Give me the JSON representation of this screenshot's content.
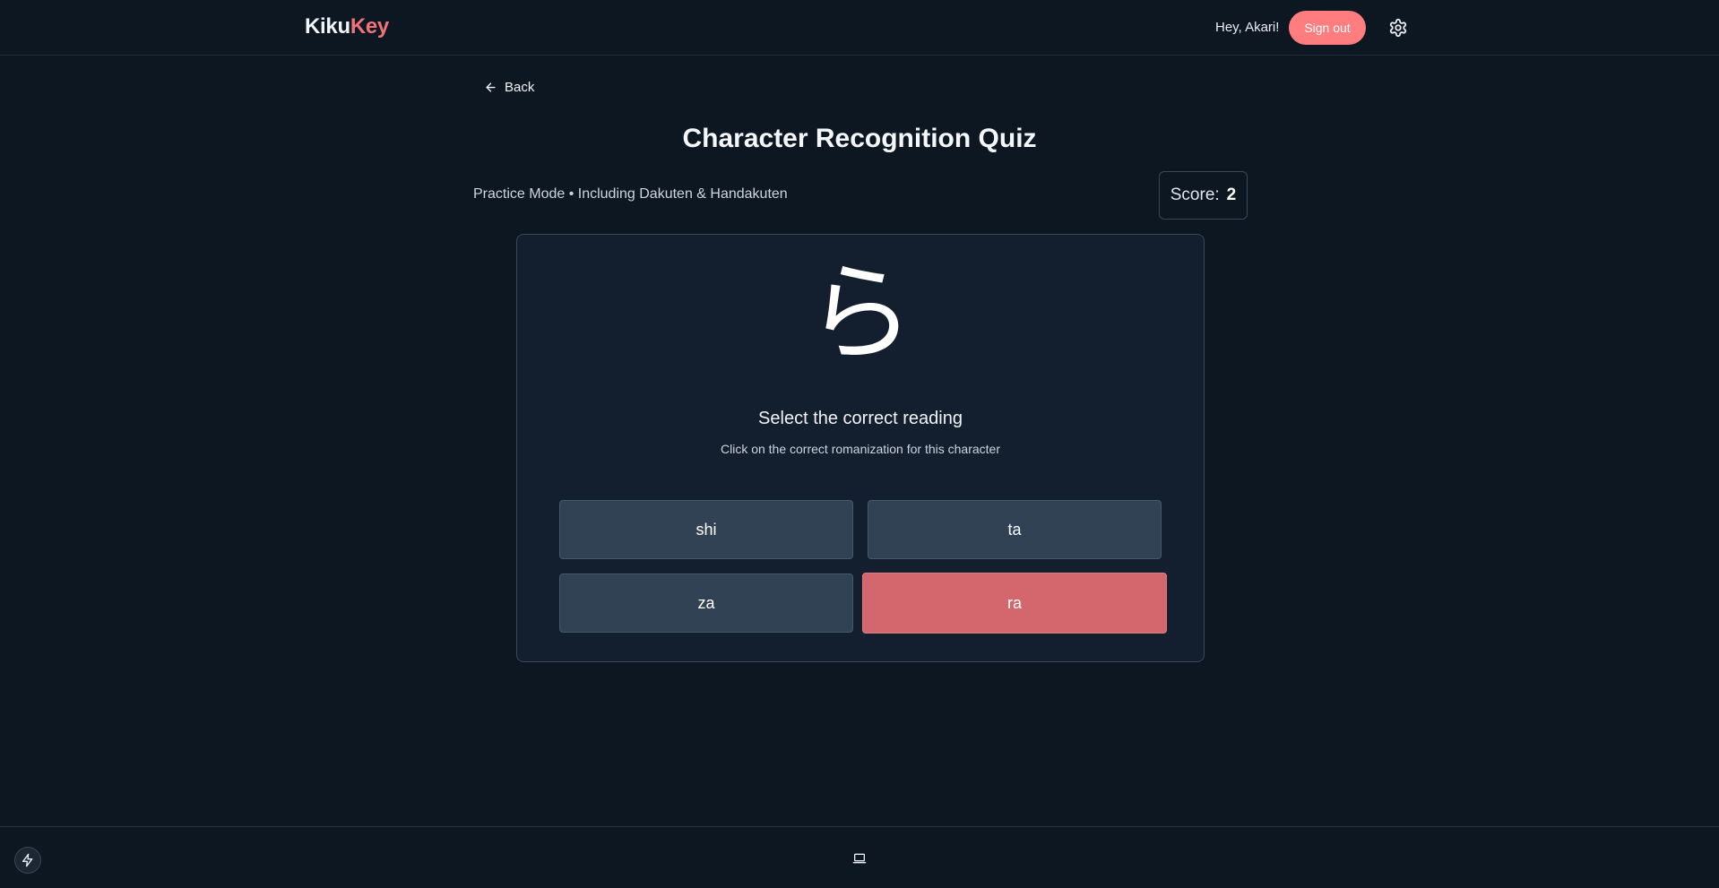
{
  "header": {
    "logo_part1": "Kiku",
    "logo_part2": "Key",
    "greeting": "Hey, Akari!",
    "signout_label": "Sign out"
  },
  "nav": {
    "back_label": "Back"
  },
  "quiz": {
    "title": "Character Recognition Quiz",
    "mode": "Practice Mode • Including Dakuten & Handakuten",
    "score_label": "Score:",
    "score_value": "2",
    "character": "ら",
    "instruction": "Select the correct reading",
    "subinstruction": "Click on the correct romanization for this character",
    "options": [
      "shi",
      "ta",
      "za",
      "ra"
    ],
    "selected_option": "ra"
  },
  "colors": {
    "background": "#0d1722",
    "card": "#131f2e",
    "accent": "#ff7c7f",
    "option": "#314255",
    "selected": "#d4666e"
  }
}
